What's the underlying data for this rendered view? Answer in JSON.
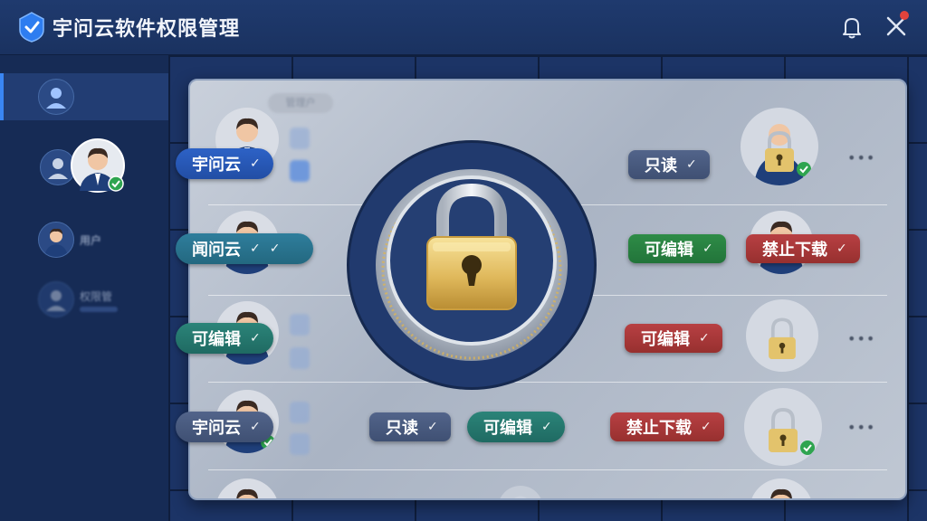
{
  "app": {
    "title": "宇问云软件权限管理"
  },
  "header": {
    "notifications_icon": "bell-icon",
    "tools_icon": "tools-icon"
  },
  "sidebar": {
    "items": [
      {
        "icon": "user-icon",
        "active": true
      },
      {
        "icon": "user-icon",
        "active": false
      },
      {
        "icon": "avatar-icon",
        "label": "用户"
      },
      {
        "icon": "user-icon",
        "label": "权限管"
      }
    ]
  },
  "panel": {
    "ghost_header": "管理户",
    "rows": [
      {
        "left": [
          "宇问云"
        ],
        "right": [
          "只读"
        ]
      },
      {
        "left": [
          "闻问云"
        ],
        "right": [
          "可编辑",
          "禁止下载"
        ]
      },
      {
        "left": [
          "可编辑"
        ],
        "right": [
          "可编辑"
        ]
      },
      {
        "left": [
          "宇问云"
        ],
        "middle": [
          "只读",
          "可编辑"
        ],
        "right": [
          "禁止下载"
        ]
      }
    ],
    "more_label": "•••"
  },
  "colors": {
    "accent": "#3a86f3",
    "blue_pill": "#2d62c6",
    "teal_pill": "#2f7e9c",
    "green_pill": "#2e8c47",
    "red_pill": "#b84043",
    "slate_pill": "#52648a",
    "lock_gold": "#e8c66a"
  }
}
